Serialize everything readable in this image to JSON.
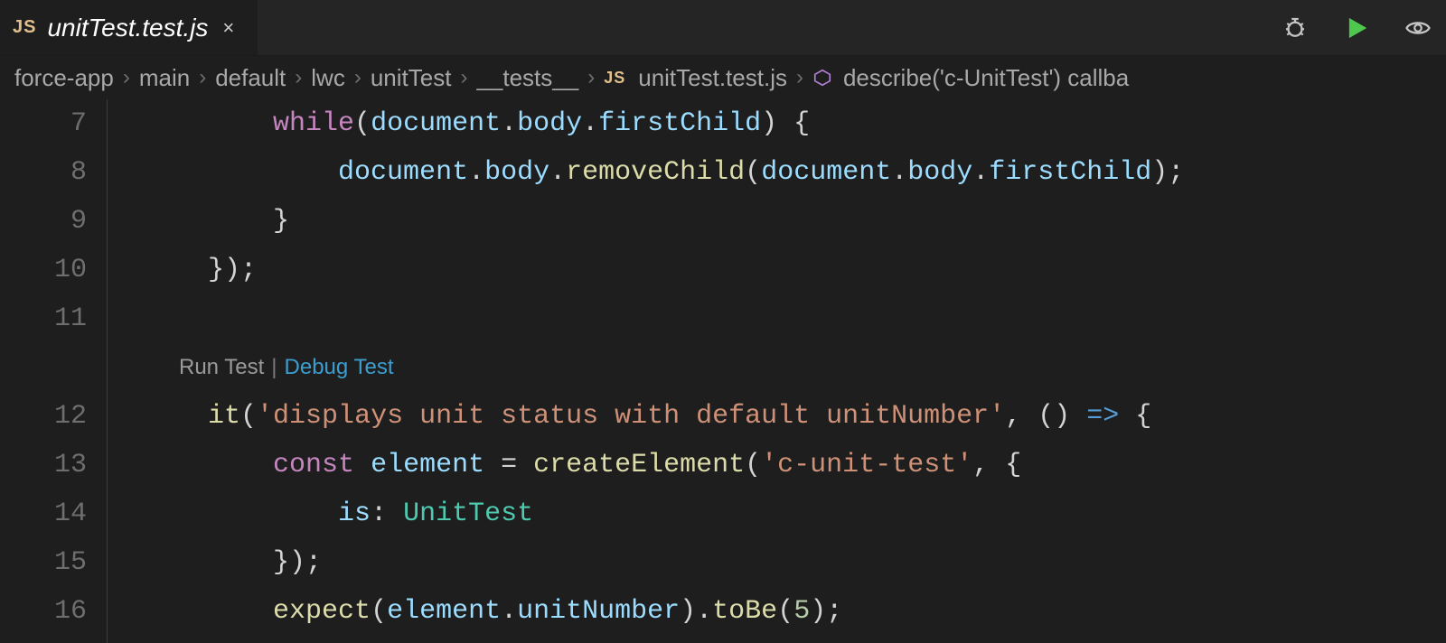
{
  "tab": {
    "filetype_badge": "JS",
    "filename": "unitTest.test.js",
    "close_glyph": "×"
  },
  "actions": {
    "debug_tooltip": "Debug",
    "run_tooltip": "Run",
    "preview_tooltip": "Preview"
  },
  "breadcrumb": {
    "sep": "›",
    "segments": [
      "force-app",
      "main",
      "default",
      "lwc",
      "unitTest",
      "__tests__"
    ],
    "file_badge": "JS",
    "file": "unitTest.test.js",
    "symbol": "describe('c-UnitTest') callba"
  },
  "codelens": {
    "run": "Run Test",
    "separator": "|",
    "debug": "Debug Test"
  },
  "code": {
    "lines": [
      {
        "num": "7",
        "indent": 2,
        "tokens": [
          {
            "t": "while",
            "c": "tok-kw"
          },
          {
            "t": "(",
            "c": "tok-punc"
          },
          {
            "t": "document",
            "c": "tok-id"
          },
          {
            "t": ".",
            "c": "tok-punc"
          },
          {
            "t": "body",
            "c": "tok-id"
          },
          {
            "t": ".",
            "c": "tok-punc"
          },
          {
            "t": "firstChild",
            "c": "tok-id"
          },
          {
            "t": ") {",
            "c": "tok-punc"
          }
        ]
      },
      {
        "num": "8",
        "indent": 3,
        "tokens": [
          {
            "t": "document",
            "c": "tok-id"
          },
          {
            "t": ".",
            "c": "tok-punc"
          },
          {
            "t": "body",
            "c": "tok-id"
          },
          {
            "t": ".",
            "c": "tok-punc"
          },
          {
            "t": "removeChild",
            "c": "tok-fn"
          },
          {
            "t": "(",
            "c": "tok-punc"
          },
          {
            "t": "document",
            "c": "tok-id"
          },
          {
            "t": ".",
            "c": "tok-punc"
          },
          {
            "t": "body",
            "c": "tok-id"
          },
          {
            "t": ".",
            "c": "tok-punc"
          },
          {
            "t": "firstChild",
            "c": "tok-id"
          },
          {
            "t": ");",
            "c": "tok-punc"
          }
        ]
      },
      {
        "num": "9",
        "indent": 2,
        "tokens": [
          {
            "t": "}",
            "c": "tok-brace"
          }
        ]
      },
      {
        "num": "10",
        "indent": 1,
        "tokens": [
          {
            "t": "});",
            "c": "tok-punc"
          }
        ]
      },
      {
        "num": "11",
        "indent": 0,
        "tokens": []
      },
      {
        "num": "",
        "indent": 1,
        "codelens": true
      },
      {
        "num": "12",
        "indent": 1,
        "tokens": [
          {
            "t": "it",
            "c": "tok-fn"
          },
          {
            "t": "(",
            "c": "tok-punc"
          },
          {
            "t": "'displays unit status with default unitNumber'",
            "c": "tok-str"
          },
          {
            "t": ", () ",
            "c": "tok-punc"
          },
          {
            "t": "=>",
            "c": "tok-arrow"
          },
          {
            "t": " {",
            "c": "tok-punc"
          }
        ]
      },
      {
        "num": "13",
        "indent": 2,
        "tokens": [
          {
            "t": "const",
            "c": "tok-kw"
          },
          {
            "t": " ",
            "c": ""
          },
          {
            "t": "element",
            "c": "tok-id"
          },
          {
            "t": " = ",
            "c": "tok-punc"
          },
          {
            "t": "createElement",
            "c": "tok-fn"
          },
          {
            "t": "(",
            "c": "tok-punc"
          },
          {
            "t": "'c-unit-test'",
            "c": "tok-str"
          },
          {
            "t": ", {",
            "c": "tok-punc"
          }
        ]
      },
      {
        "num": "14",
        "indent": 3,
        "tokens": [
          {
            "t": "is",
            "c": "tok-id"
          },
          {
            "t": ": ",
            "c": "tok-punc"
          },
          {
            "t": "UnitTest",
            "c": "tok-type"
          }
        ]
      },
      {
        "num": "15",
        "indent": 2,
        "tokens": [
          {
            "t": "});",
            "c": "tok-punc"
          }
        ]
      },
      {
        "num": "16",
        "indent": 2,
        "tokens": [
          {
            "t": "expect",
            "c": "tok-fn"
          },
          {
            "t": "(",
            "c": "tok-punc"
          },
          {
            "t": "element",
            "c": "tok-id"
          },
          {
            "t": ".",
            "c": "tok-punc"
          },
          {
            "t": "unitNumber",
            "c": "tok-id"
          },
          {
            "t": ").",
            "c": "tok-punc"
          },
          {
            "t": "toBe",
            "c": "tok-fn"
          },
          {
            "t": "(",
            "c": "tok-punc"
          },
          {
            "t": "5",
            "c": "tok-num"
          },
          {
            "t": ");",
            "c": "tok-punc"
          }
        ]
      }
    ]
  }
}
